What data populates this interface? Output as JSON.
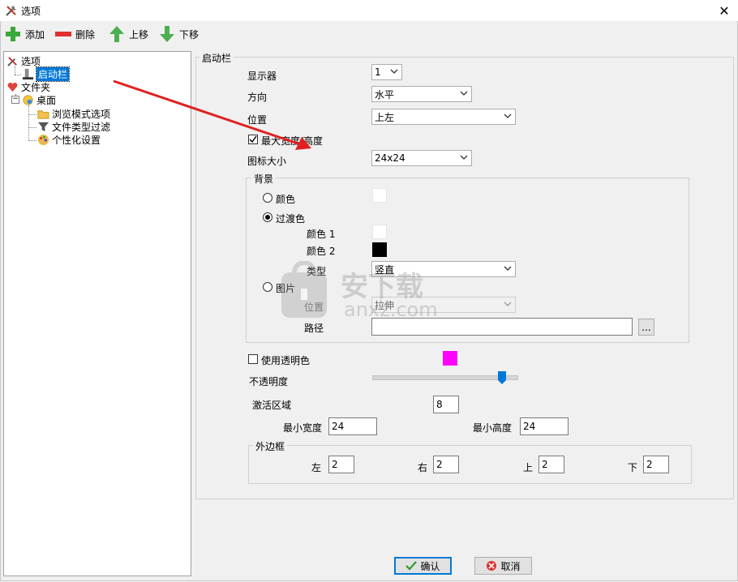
{
  "window": {
    "title": "选项",
    "close_glyph": "✕"
  },
  "toolbar": {
    "add_label": "添加",
    "delete_label": "删除",
    "up_label": "上移",
    "down_label": "下移"
  },
  "tree": {
    "root": "选项",
    "launcher": "启动栏",
    "folder": "文件夹",
    "desktop": "桌面",
    "browse_mode": "浏览模式选项",
    "filetype_filter": "文件类型过滤",
    "personalize": "个性化设置"
  },
  "launcher": {
    "group_title": "启动栏",
    "display_label": "显示器",
    "display_value": "1",
    "direction_label": "方向",
    "direction_value": "水平",
    "position_label": "位置",
    "position_value": "上左",
    "max_wh_label": "最大宽度/高度",
    "icon_size_label": "图标大小",
    "icon_size_value": "24x24",
    "background": {
      "title": "背景",
      "color_label": "颜色",
      "gradient_label": "过渡色",
      "color1_label": "颜色 1",
      "color2_label": "颜色 2",
      "type_label": "类型",
      "type_value": "竖直",
      "image_label": "图片",
      "img_position_label": "位置",
      "img_position_value": "拉伸",
      "path_label": "路径",
      "path_value": "",
      "browse_label": "...",
      "selected": "gradient",
      "color_swatch": "#ffffff",
      "color1_swatch": "#ffffff",
      "color2_swatch": "#000000"
    },
    "transparent_label": "使用透明色",
    "transparent_swatch": "#ff00ff",
    "opacity_label": "不透明度",
    "opacity_fraction": 0.9,
    "activation_label": "激活区域",
    "activation_value": "8",
    "min_width_label": "最小宽度",
    "min_width_value": "24",
    "min_height_label": "最小高度",
    "min_height_value": "24",
    "border": {
      "title": "外边框",
      "left_label": "左",
      "left_value": "2",
      "right_label": "右",
      "right_value": "2",
      "top_label": "上",
      "top_value": "2",
      "bottom_label": "下",
      "bottom_value": "2"
    }
  },
  "footer": {
    "ok_label": "确认",
    "cancel_label": "取消"
  },
  "colors": {
    "accent": "#0078d7",
    "arrow": "#e02020"
  },
  "watermark": {
    "text_cn": "安下载",
    "text_en": "anxz.com"
  }
}
